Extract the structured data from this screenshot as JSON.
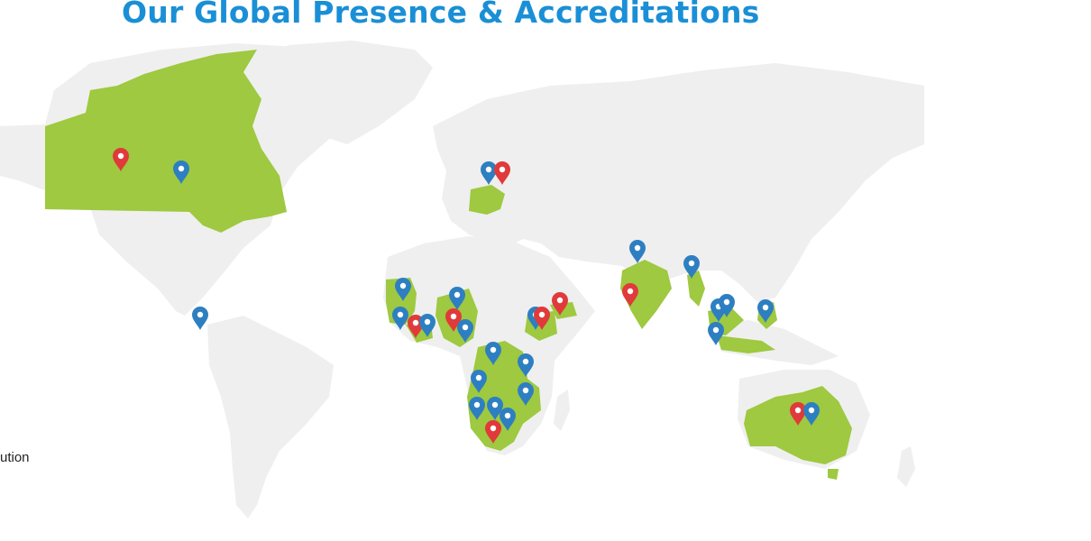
{
  "header": {
    "title": "Our Global Presence & Accreditations"
  },
  "legend": {
    "fragment": "ution"
  },
  "colors": {
    "title": "#1a8fd6",
    "land": "#efefef",
    "highlight": "#9ec940",
    "pin_blue": "#2d7fc1",
    "pin_red": "#e03a3a"
  },
  "highlighted_countries": [
    "Canada",
    "Poland",
    "Senegal",
    "Guinea",
    "Nigeria",
    "Ghana",
    "Cameroon",
    "Ethiopia",
    "Yemen",
    "Angola",
    "Zambia",
    "Malawi",
    "Tanzania",
    "Mozambique",
    "Namibia",
    "Botswana",
    "Zimbabwe",
    "South Africa",
    "India",
    "Myanmar",
    "Malaysia",
    "Indonesia",
    "Philippines",
    "Australia"
  ],
  "pins": [
    {
      "place": "Canada west",
      "color": "red"
    },
    {
      "place": "Canada east",
      "color": "blue"
    },
    {
      "place": "Poland",
      "color": "blue"
    },
    {
      "place": "Poland",
      "color": "red"
    },
    {
      "place": "Central America",
      "color": "blue"
    },
    {
      "place": "Senegal",
      "color": "blue"
    },
    {
      "place": "Guinea",
      "color": "blue"
    },
    {
      "place": "Sierra Leone",
      "color": "red"
    },
    {
      "place": "Liberia",
      "color": "blue"
    },
    {
      "place": "Nigeria north",
      "color": "blue"
    },
    {
      "place": "Nigeria",
      "color": "red"
    },
    {
      "place": "Cameroon",
      "color": "blue"
    },
    {
      "place": "Ethiopia",
      "color": "blue"
    },
    {
      "place": "Ethiopia",
      "color": "red"
    },
    {
      "place": "Yemen",
      "color": "red"
    },
    {
      "place": "DR Congo",
      "color": "blue"
    },
    {
      "place": "Kenya",
      "color": "blue"
    },
    {
      "place": "Angola",
      "color": "blue"
    },
    {
      "place": "Tanzania",
      "color": "blue"
    },
    {
      "place": "Namibia",
      "color": "blue"
    },
    {
      "place": "Botswana",
      "color": "blue"
    },
    {
      "place": "Zimbabwe",
      "color": "blue"
    },
    {
      "place": "South Africa",
      "color": "red"
    },
    {
      "place": "Pakistan",
      "color": "blue"
    },
    {
      "place": "India west",
      "color": "red"
    },
    {
      "place": "Myanmar",
      "color": "blue"
    },
    {
      "place": "Malaysia",
      "color": "blue"
    },
    {
      "place": "Malaysia",
      "color": "blue"
    },
    {
      "place": "Indonesia",
      "color": "blue"
    },
    {
      "place": "Philippines",
      "color": "blue"
    },
    {
      "place": "Australia",
      "color": "red"
    },
    {
      "place": "Australia",
      "color": "blue"
    }
  ]
}
